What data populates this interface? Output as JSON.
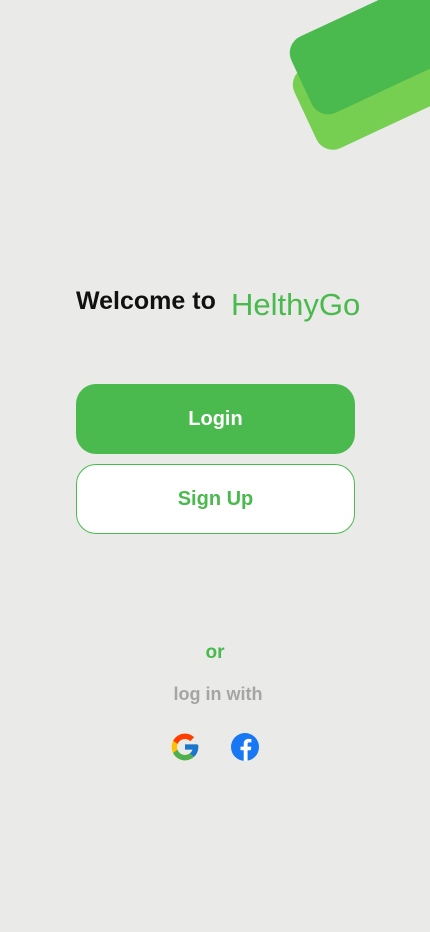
{
  "welcome": {
    "prefix": "Welcome to",
    "brand": "HelthyGo"
  },
  "buttons": {
    "login_label": "Login",
    "signup_label": "Sign Up"
  },
  "divider": {
    "or_label": "or",
    "login_with_label": "log in with"
  },
  "social": [
    {
      "icon": "google-icon"
    },
    {
      "icon": "facebook-icon"
    }
  ],
  "colors": {
    "brand_green": "#4aba4e",
    "light_green": "#76cf50",
    "background": "#eaeae8",
    "muted_text": "#a5a5a5",
    "facebook_blue": "#1877f2"
  }
}
